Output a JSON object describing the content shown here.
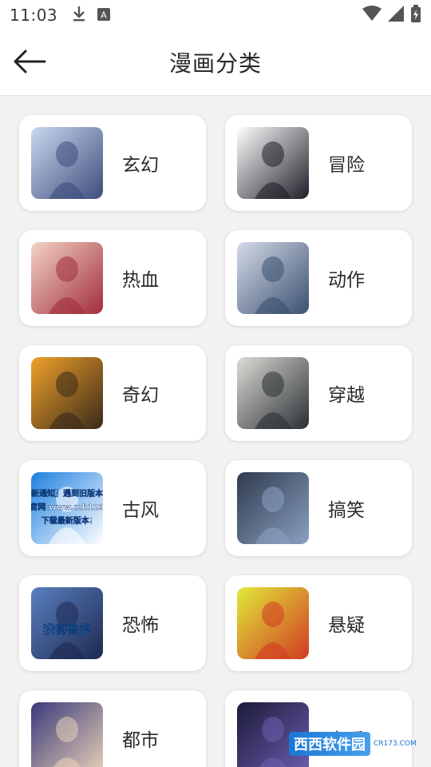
{
  "status_bar": {
    "time": "11:03",
    "icons": [
      "download-icon",
      "notification-a-icon",
      "wifi-icon",
      "signal-icon",
      "battery-icon"
    ]
  },
  "header": {
    "title": "漫画分类",
    "back_icon": "arrow-left-icon"
  },
  "categories": [
    {
      "label": "玄幻",
      "thumb_palette": [
        "#c9d8ee",
        "#3d4d7c"
      ]
    },
    {
      "label": "冒险",
      "thumb_palette": [
        "#ffffff",
        "#1e1e28"
      ]
    },
    {
      "label": "热血",
      "thumb_palette": [
        "#f3d3c7",
        "#a12d3a"
      ]
    },
    {
      "label": "动作",
      "thumb_palette": [
        "#d5dbe8",
        "#3b5070"
      ]
    },
    {
      "label": "奇幻",
      "thumb_palette": [
        "#f0a12a",
        "#3a2a1a"
      ]
    },
    {
      "label": "穿越",
      "thumb_palette": [
        "#dcdcd6",
        "#2b2f33"
      ]
    },
    {
      "label": "古风",
      "thumb_palette": [
        "#1e7fe0",
        "#ffffff"
      ],
      "thumb_text": [
        "新通知】遇到旧版本",
        "官网:www.mh123",
        "下载最新版本!"
      ]
    },
    {
      "label": "搞笑",
      "thumb_palette": [
        "#2f3a4e",
        "#8aa0c0"
      ]
    },
    {
      "label": "恐怖",
      "thumb_palette": [
        "#5a7fbf",
        "#1d2a52"
      ],
      "thumb_text": [
        "我御兽娘"
      ]
    },
    {
      "label": "悬疑",
      "thumb_palette": [
        "#e0ea3a",
        "#d13a22"
      ]
    },
    {
      "label": "都市",
      "thumb_palette": [
        "#3a3a7a",
        "#e8d0b8"
      ]
    },
    {
      "label": "恋爱",
      "thumb_palette": [
        "#1c1a3a",
        "#6b5fb0"
      ]
    }
  ],
  "watermark": {
    "main": "西西软件园",
    "sub": "CR173.COM"
  }
}
